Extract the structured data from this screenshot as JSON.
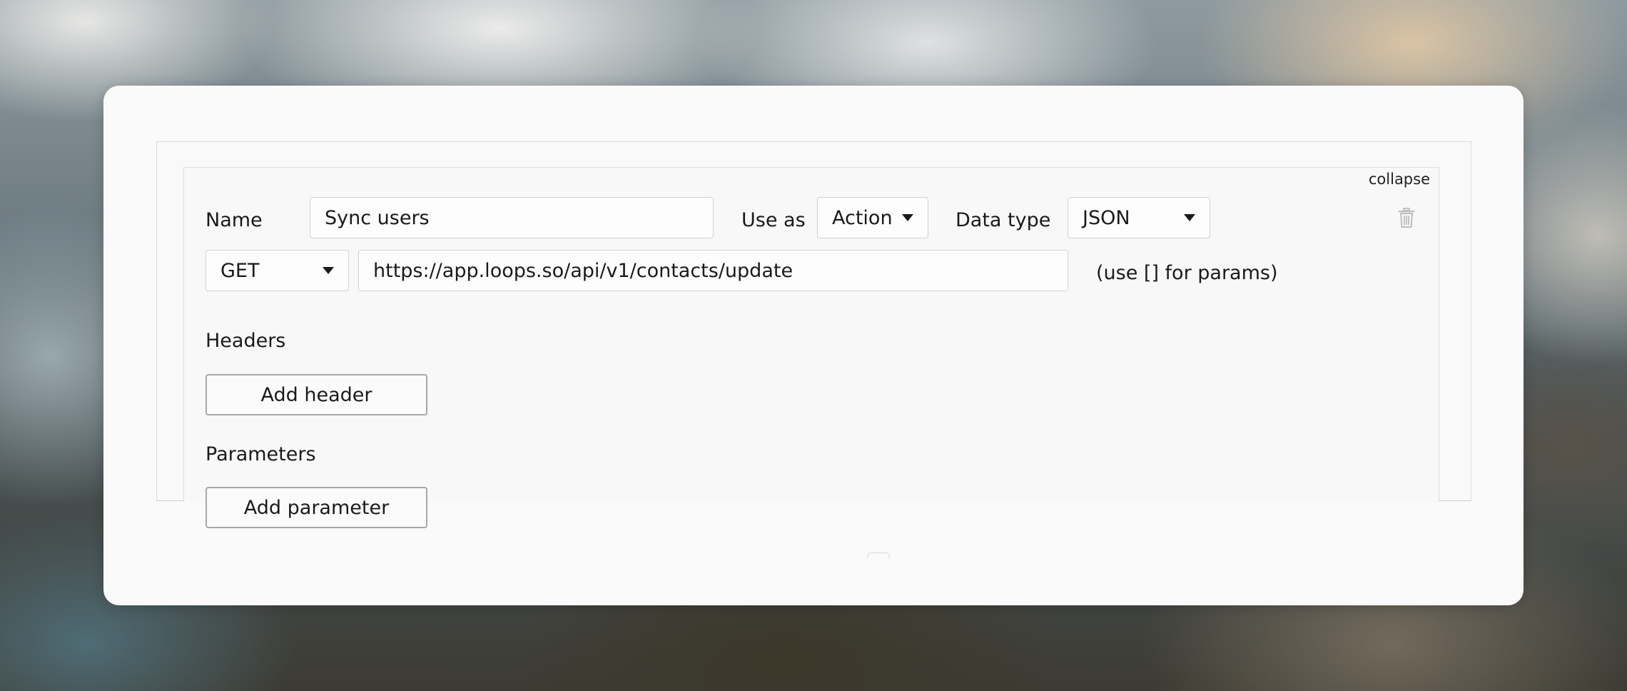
{
  "panel": {
    "collapse_label": "collapse",
    "name_label": "Name",
    "name_value": "Sync users",
    "use_as_label": "Use as",
    "use_as_value": "Action",
    "data_type_label": "Data type",
    "data_type_value": "JSON",
    "method_value": "GET",
    "url_value": "https://app.loops.so/api/v1/contacts/update",
    "url_hint": "(use [] for params)",
    "headers_label": "Headers",
    "add_header_label": "Add header",
    "parameters_label": "Parameters",
    "add_parameter_label": "Add parameter",
    "delete_icon": "trash-icon"
  }
}
